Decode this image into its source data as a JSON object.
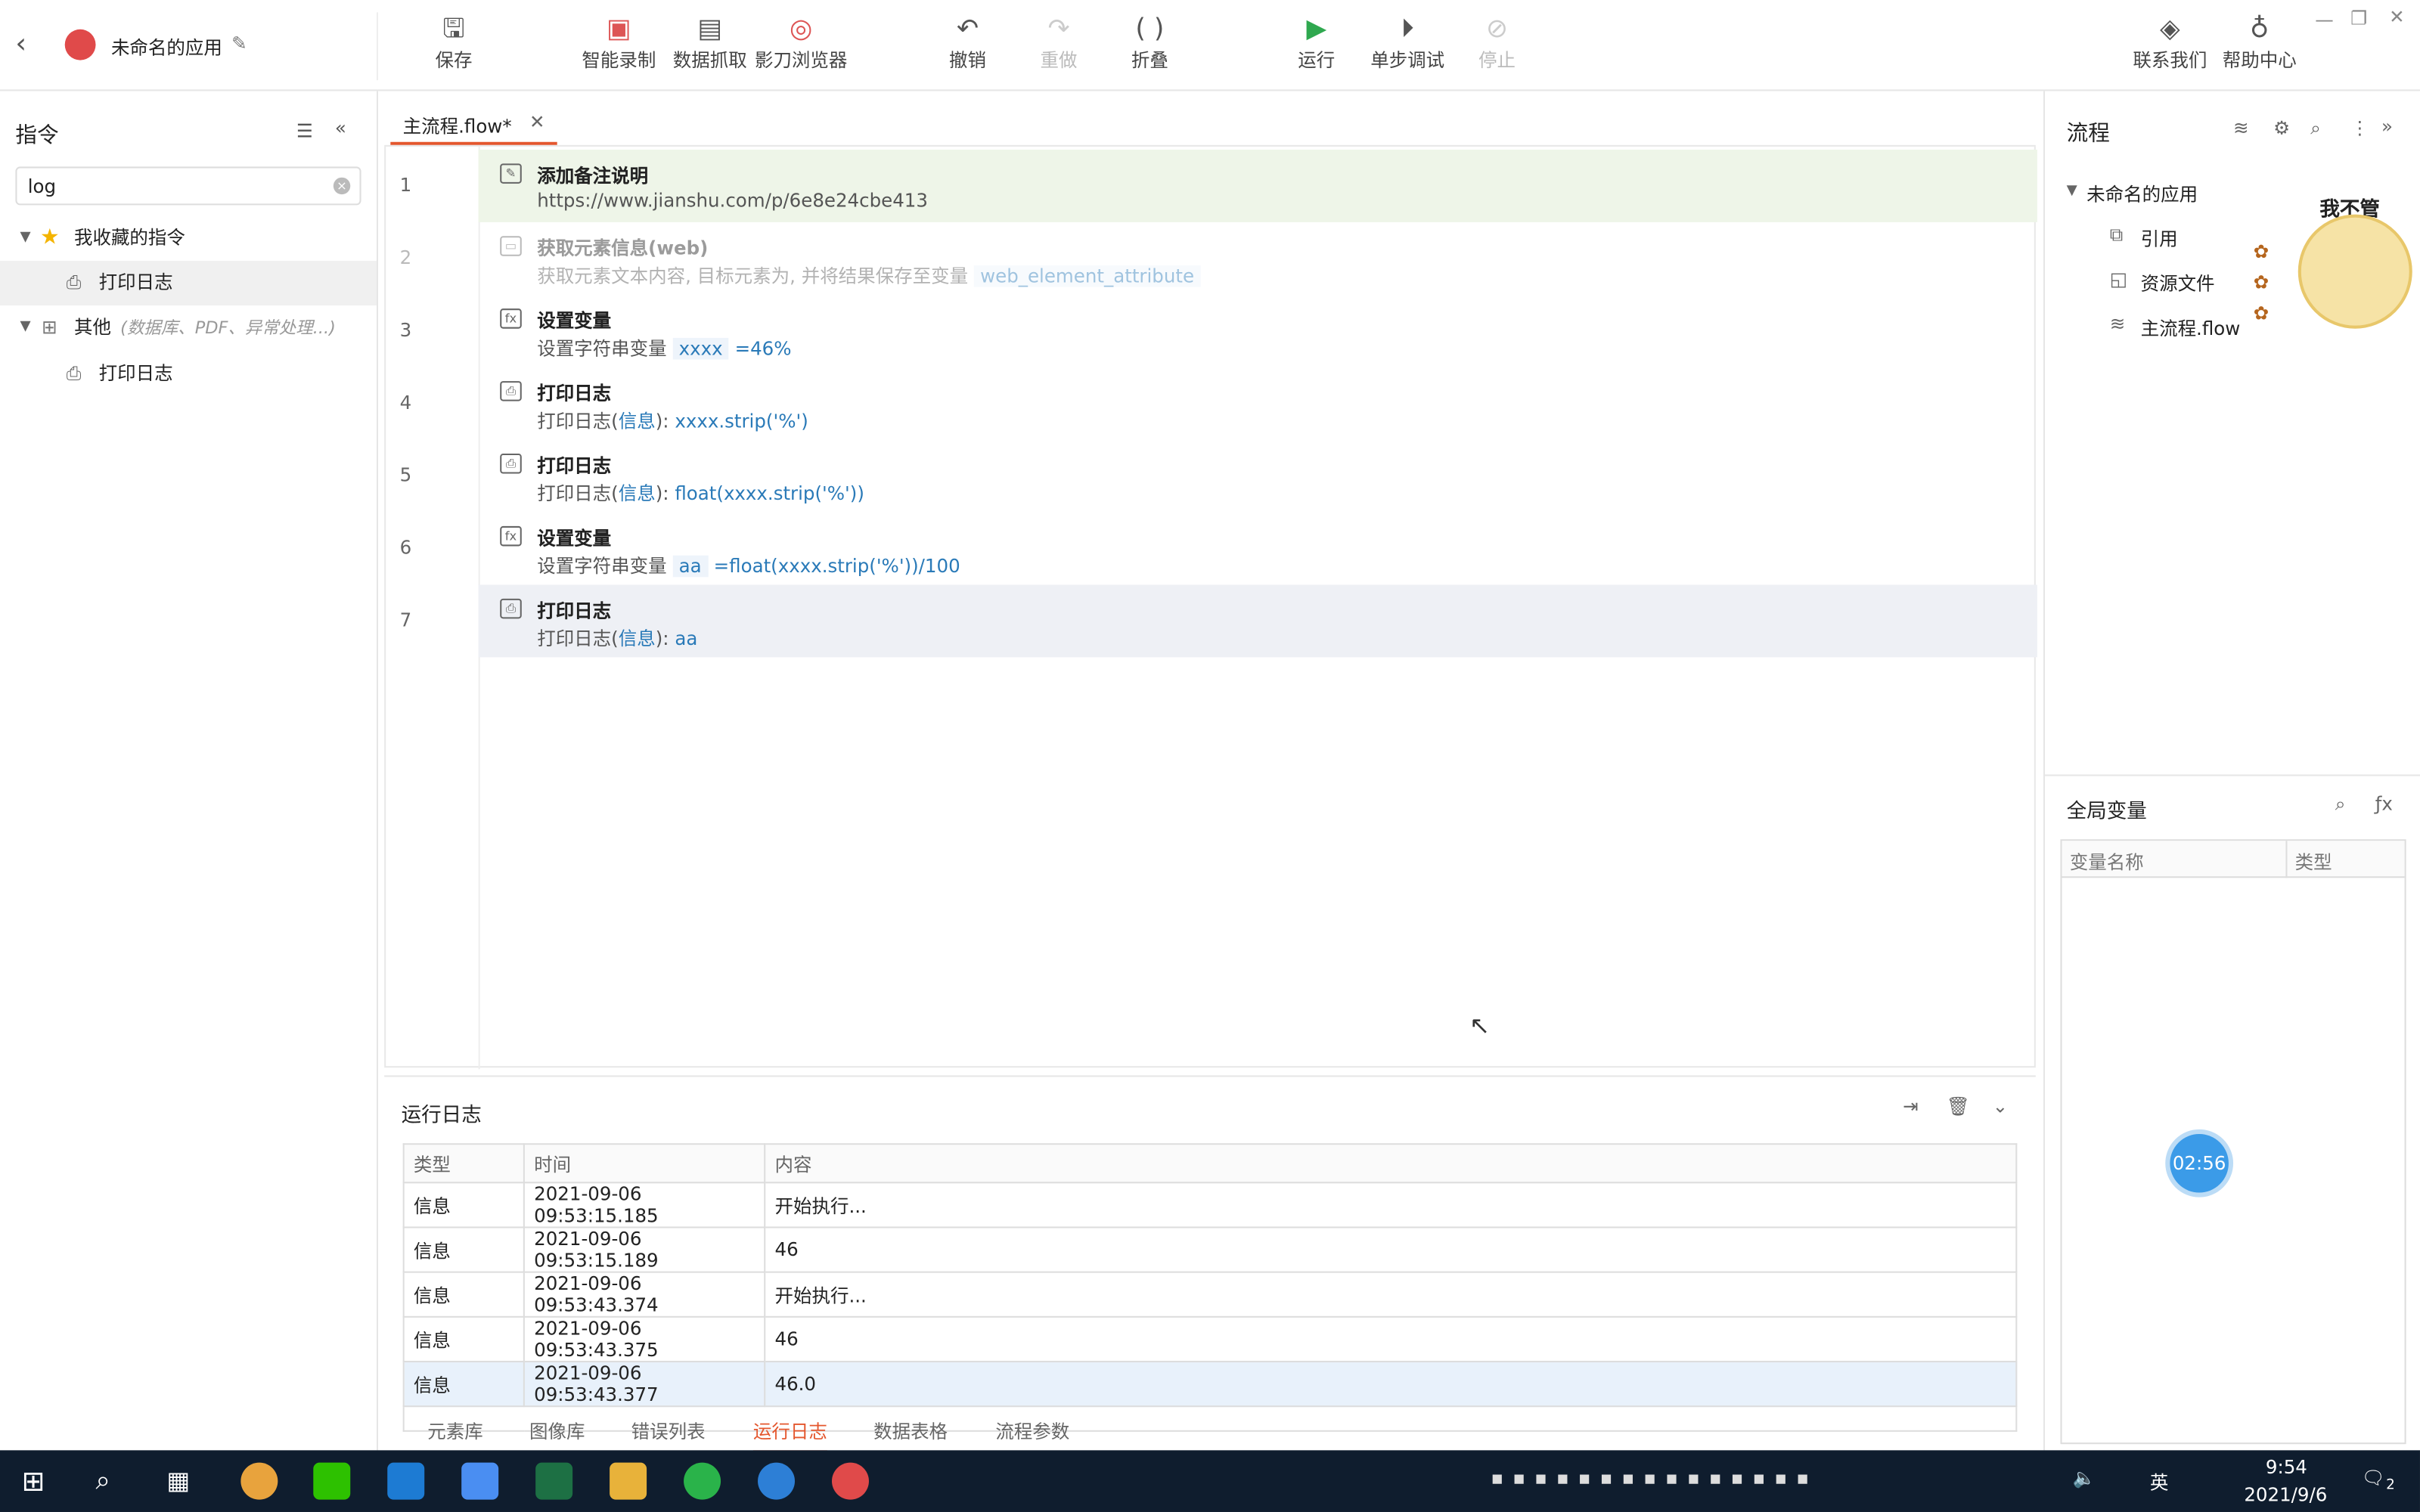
{
  "header": {
    "app_name": "未命名的应用",
    "back_icon": "back-arrow-icon"
  },
  "toolbar": {
    "save": "保存",
    "smart_record": "智能录制",
    "data_capture": "数据抓取",
    "browser": "影刀浏览器",
    "undo": "撤销",
    "redo": "重做",
    "fold": "折叠",
    "run": "运行",
    "step_debug": "单步调试",
    "stop": "停止",
    "contact": "联系我们",
    "help": "帮助中心"
  },
  "left": {
    "title": "指令",
    "search_value": "log",
    "fav_group": "我收藏的指令",
    "fav_item": "打印日志",
    "other_group": "其他",
    "other_hint": "(数据库、PDF、异常处理...)",
    "other_item": "打印日志"
  },
  "editor": {
    "tab": "主流程.flow*",
    "rows": [
      {
        "num": "1",
        "title": "添加备注说明",
        "desc": "https://www.jianshu.com/p/6e8e24cbe413"
      },
      {
        "num": "2",
        "title": "获取元素信息(web)",
        "desc": "获取元素文本内容, 目标元素为, 并将结果保存至变量",
        "var": "web_element_attribute"
      },
      {
        "num": "3",
        "title": "设置变量",
        "desc": "设置字符串变量",
        "var": "xxxx",
        "tail": "=46%"
      },
      {
        "num": "4",
        "title": "打印日志",
        "desc": "打印日志(",
        "level": "信息",
        "close": "):",
        "var": "xxxx.strip('%')"
      },
      {
        "num": "5",
        "title": "打印日志",
        "desc": "打印日志(",
        "level": "信息",
        "close": "):",
        "var": "float(xxxx.strip('%'))"
      },
      {
        "num": "6",
        "title": "设置变量",
        "desc": "设置字符串变量",
        "var": "aa",
        "tail": "=float(xxxx.strip('%'))/100"
      },
      {
        "num": "7",
        "title": "打印日志",
        "desc": "打印日志(",
        "level": "信息",
        "close": "):",
        "var": "aa"
      }
    ]
  },
  "log": {
    "title": "运行日志",
    "headers": [
      "类型",
      "时间",
      "内容"
    ],
    "rows": [
      [
        "信息",
        "2021-09-06 09:53:15.185",
        "开始执行..."
      ],
      [
        "信息",
        "2021-09-06 09:53:15.189",
        "46"
      ],
      [
        "信息",
        "2021-09-06 09:53:43.374",
        "开始执行..."
      ],
      [
        "信息",
        "2021-09-06 09:53:43.375",
        "46"
      ],
      [
        "信息",
        "2021-09-06 09:53:43.377",
        "46.0"
      ]
    ],
    "tabs": [
      "元素库",
      "图像库",
      "错误列表",
      "运行日志",
      "数据表格",
      "流程参数"
    ]
  },
  "right": {
    "flow_title": "流程",
    "root": "未命名的应用",
    "ref": "引用",
    "resources": "资源文件",
    "main_flow": "主流程.flow",
    "sticker_text": "我不管",
    "globals_title": "全局变量",
    "col_name": "变量名称",
    "col_type": "类型",
    "timer": "02:56"
  },
  "taskbar": {
    "lang": "英",
    "time": "9:54",
    "date": "2021/9/6",
    "notify": "2"
  },
  "colors": {
    "accent": "#2a7ab8",
    "run": "#2fa84f",
    "stop": "#e77777",
    "active_tab": "#e4572e"
  }
}
